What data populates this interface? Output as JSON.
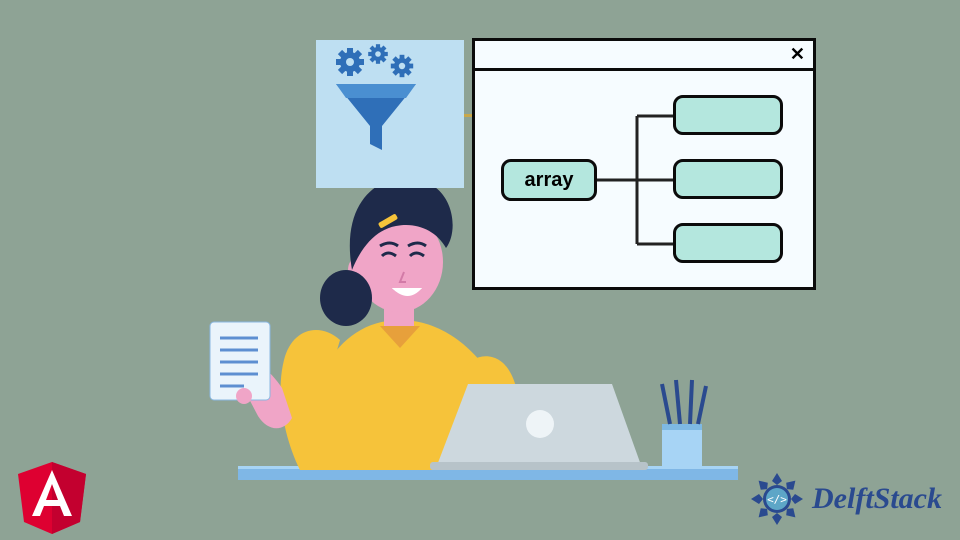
{
  "illustration": {
    "background_color": "#8ea395",
    "diagram": {
      "root_label": "array",
      "leaves": [
        "",
        "",
        ""
      ],
      "close_symbol": "✕",
      "node_fill": "#b4e7de",
      "window_fill": "#f6fcff"
    },
    "funnel_tile_fill": "#bedff2"
  },
  "angular_logo": {
    "letter": "A",
    "fill": "#de0031"
  },
  "watermark": {
    "brand_text": "DelftStack",
    "accent_color": "#2a4a8f"
  }
}
